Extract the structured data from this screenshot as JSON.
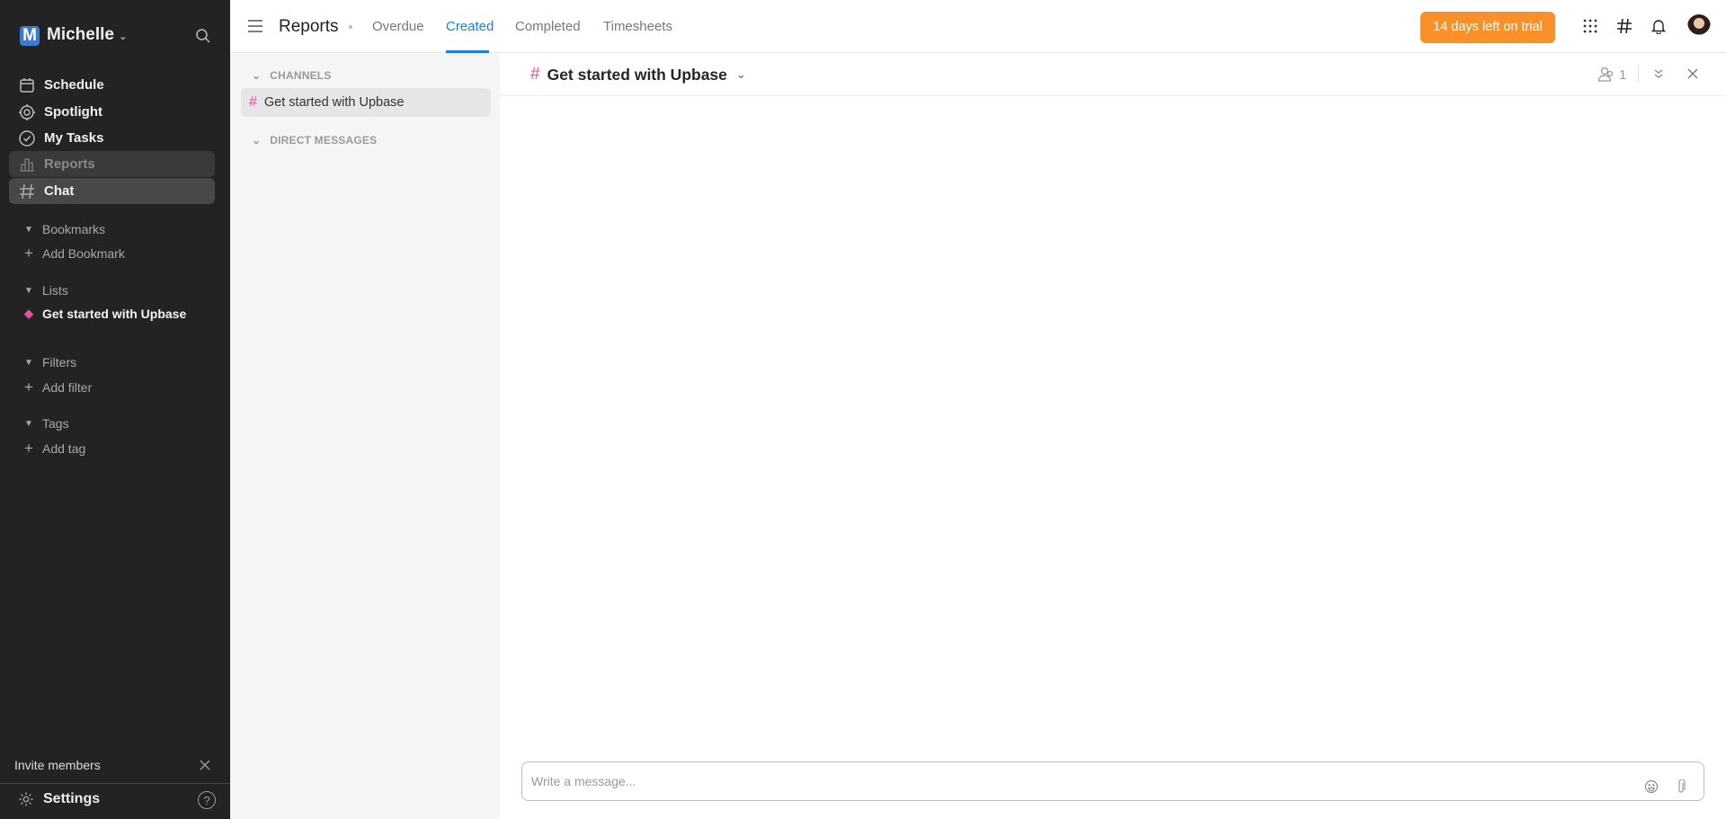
{
  "sidebar": {
    "workspace_initial": "M",
    "workspace_name": "Michelle",
    "nav": [
      {
        "label": "Schedule"
      },
      {
        "label": "Spotlight"
      },
      {
        "label": "My Tasks"
      },
      {
        "label": "Reports"
      },
      {
        "label": "Chat"
      }
    ],
    "bookmarks": {
      "title": "Bookmarks",
      "add": "Add Bookmark"
    },
    "lists": {
      "title": "Lists",
      "items": [
        {
          "label": "Get started with Upbase",
          "color": "#e44f9c"
        }
      ]
    },
    "filters": {
      "title": "Filters",
      "add": "Add filter"
    },
    "tags": {
      "title": "Tags",
      "add": "Add tag"
    },
    "invite": "Invite members",
    "settings": "Settings"
  },
  "header": {
    "title": "Reports",
    "tabs": [
      {
        "label": "Overdue"
      },
      {
        "label": "Created",
        "active": true
      },
      {
        "label": "Completed"
      },
      {
        "label": "Timesheets"
      }
    ],
    "trial": "14 days left on trial"
  },
  "channels": {
    "channels_title": "CHANNELS",
    "items": [
      {
        "label": "Get started with Upbase"
      }
    ],
    "dm_title": "DIRECT MESSAGES"
  },
  "chat": {
    "title": "Get started with Upbase",
    "member_count": "1",
    "input_placeholder": "Write a message..."
  }
}
